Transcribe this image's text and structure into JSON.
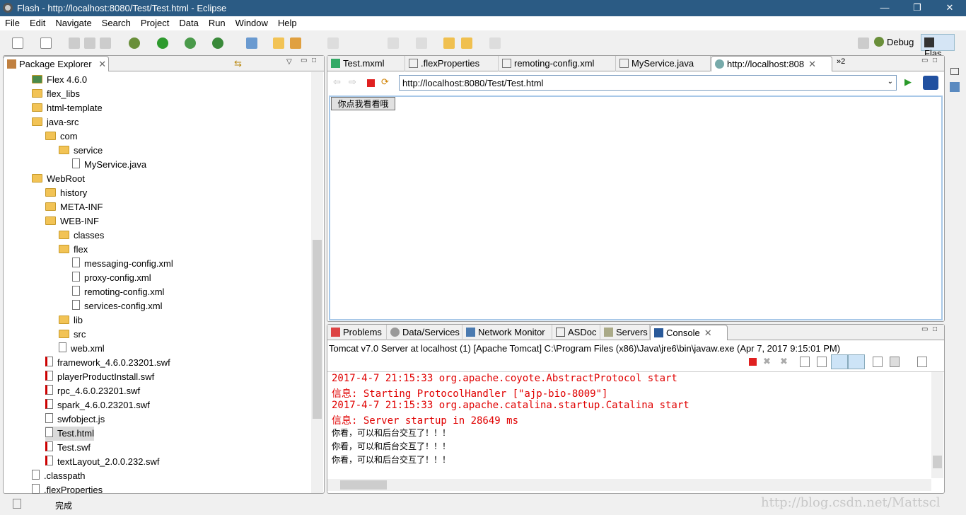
{
  "window": {
    "title": "Flash - http://localhost:8080/Test/Test.html - Eclipse",
    "minimize": "—",
    "maximize": "❐",
    "close": "✕"
  },
  "menu": [
    "File",
    "Edit",
    "Navigate",
    "Search",
    "Project",
    "Data",
    "Run",
    "Window",
    "Help"
  ],
  "perspectives": {
    "debug": "Debug",
    "flash": "Flas"
  },
  "package_explorer": {
    "title": "Package Explorer",
    "items": [
      {
        "label": "Flex 4.6.0",
        "level": 0,
        "type": "lib"
      },
      {
        "label": "flex_libs",
        "level": 0,
        "type": "folder"
      },
      {
        "label": "html-template",
        "level": 0,
        "type": "folder"
      },
      {
        "label": "java-src",
        "level": 0,
        "type": "folder"
      },
      {
        "label": "com",
        "level": 1,
        "type": "folder"
      },
      {
        "label": "service",
        "level": 2,
        "type": "folder"
      },
      {
        "label": "MyService.java",
        "level": 3,
        "type": "file"
      },
      {
        "label": "WebRoot",
        "level": 0,
        "type": "folder"
      },
      {
        "label": "history",
        "level": 1,
        "type": "folder"
      },
      {
        "label": "META-INF",
        "level": 1,
        "type": "folder"
      },
      {
        "label": "WEB-INF",
        "level": 1,
        "type": "folder"
      },
      {
        "label": "classes",
        "level": 2,
        "type": "folder"
      },
      {
        "label": "flex",
        "level": 2,
        "type": "folder"
      },
      {
        "label": "messaging-config.xml",
        "level": 3,
        "type": "file"
      },
      {
        "label": "proxy-config.xml",
        "level": 3,
        "type": "file"
      },
      {
        "label": "remoting-config.xml",
        "level": 3,
        "type": "file"
      },
      {
        "label": "services-config.xml",
        "level": 3,
        "type": "file"
      },
      {
        "label": "lib",
        "level": 2,
        "type": "folder"
      },
      {
        "label": "src",
        "level": 2,
        "type": "folder"
      },
      {
        "label": "web.xml",
        "level": 2,
        "type": "file"
      },
      {
        "label": "framework_4.6.0.23201.swf",
        "level": 1,
        "type": "swf"
      },
      {
        "label": "playerProductInstall.swf",
        "level": 1,
        "type": "swf"
      },
      {
        "label": "rpc_4.6.0.23201.swf",
        "level": 1,
        "type": "swf"
      },
      {
        "label": "spark_4.6.0.23201.swf",
        "level": 1,
        "type": "swf"
      },
      {
        "label": "swfobject.js",
        "level": 1,
        "type": "file"
      },
      {
        "label": "Test.html",
        "level": 1,
        "type": "file",
        "selected": true
      },
      {
        "label": "Test.swf",
        "level": 1,
        "type": "swf"
      },
      {
        "label": "textLayout_2.0.0.232.swf",
        "level": 1,
        "type": "swf"
      },
      {
        "label": ".classpath",
        "level": 0,
        "type": "file"
      },
      {
        "label": ".flexProperties",
        "level": 0,
        "type": "file"
      }
    ]
  },
  "editor": {
    "tabs": [
      "Test.mxml",
      ".flexProperties",
      "remoting-config.xml",
      "MyService.java",
      "http://localhost:808"
    ],
    "overflow": "»2",
    "url": "http://localhost:8080/Test/Test.html",
    "page_button": "你点我看看哦"
  },
  "console": {
    "tabs": [
      "Problems",
      "Data/Services",
      "Network Monitor",
      "ASDoc",
      "Servers",
      "Console"
    ],
    "process": "Tomcat v7.0 Server at localhost (1) [Apache Tomcat] C:\\Program Files (x86)\\Java\\jre6\\bin\\javaw.exe (Apr 7, 2017 9:15:01 PM)",
    "lines": [
      {
        "text": "2017-4-7 21:15:33 org.apache.coyote.AbstractProtocol start",
        "color": "#e00000"
      },
      {
        "text": "信息: Starting ProtocolHandler [\"ajp-bio-8009\"]",
        "color": "#e00000"
      },
      {
        "text": "2017-4-7 21:15:33 org.apache.catalina.startup.Catalina start",
        "color": "#e00000"
      },
      {
        "text": "信息: Server startup in 28649 ms",
        "color": "#e00000"
      },
      {
        "text": "你看，可以和后台交互了！！！",
        "color": "#000000"
      },
      {
        "text": "你看，可以和后台交互了！！！",
        "color": "#000000"
      },
      {
        "text": "你看，可以和后台交互了！！！",
        "color": "#000000"
      }
    ]
  },
  "status": {
    "text": "完成",
    "watermark": "http://blog.csdn.net/Mattscl"
  }
}
